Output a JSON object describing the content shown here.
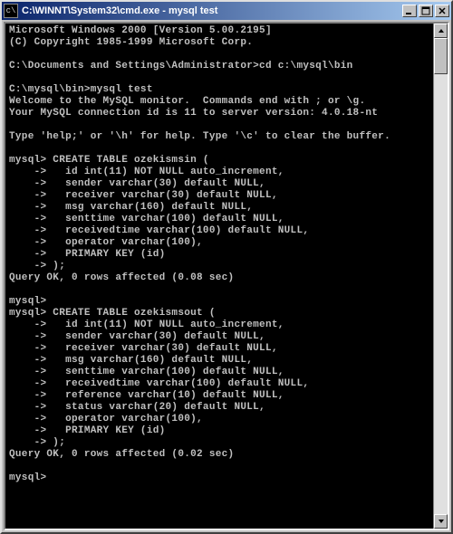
{
  "window": {
    "title": "C:\\WINNT\\System32\\cmd.exe - mysql test"
  },
  "terminal": {
    "lines": [
      "Microsoft Windows 2000 [Version 5.00.2195]",
      "(C) Copyright 1985-1999 Microsoft Corp.",
      "",
      "C:\\Documents and Settings\\Administrator>cd c:\\mysql\\bin",
      "",
      "C:\\mysql\\bin>mysql test",
      "Welcome to the MySQL monitor.  Commands end with ; or \\g.",
      "Your MySQL connection id is 11 to server version: 4.0.18-nt",
      "",
      "Type 'help;' or '\\h' for help. Type '\\c' to clear the buffer.",
      "",
      "mysql> CREATE TABLE ozekismsin (",
      "    ->   id int(11) NOT NULL auto_increment,",
      "    ->   sender varchar(30) default NULL,",
      "    ->   receiver varchar(30) default NULL,",
      "    ->   msg varchar(160) default NULL,",
      "    ->   senttime varchar(100) default NULL,",
      "    ->   receivedtime varchar(100) default NULL,",
      "    ->   operator varchar(100),",
      "    ->   PRIMARY KEY (id)",
      "    -> );",
      "Query OK, 0 rows affected (0.08 sec)",
      "",
      "mysql>",
      "mysql> CREATE TABLE ozekismsout (",
      "    ->   id int(11) NOT NULL auto_increment,",
      "    ->   sender varchar(30) default NULL,",
      "    ->   receiver varchar(30) default NULL,",
      "    ->   msg varchar(160) default NULL,",
      "    ->   senttime varchar(100) default NULL,",
      "    ->   receivedtime varchar(100) default NULL,",
      "    ->   reference varchar(10) default NULL,",
      "    ->   status varchar(20) default NULL,",
      "    ->   operator varchar(100),",
      "    ->   PRIMARY KEY (id)",
      "    -> );",
      "Query OK, 0 rows affected (0.02 sec)",
      "",
      "mysql>"
    ]
  }
}
